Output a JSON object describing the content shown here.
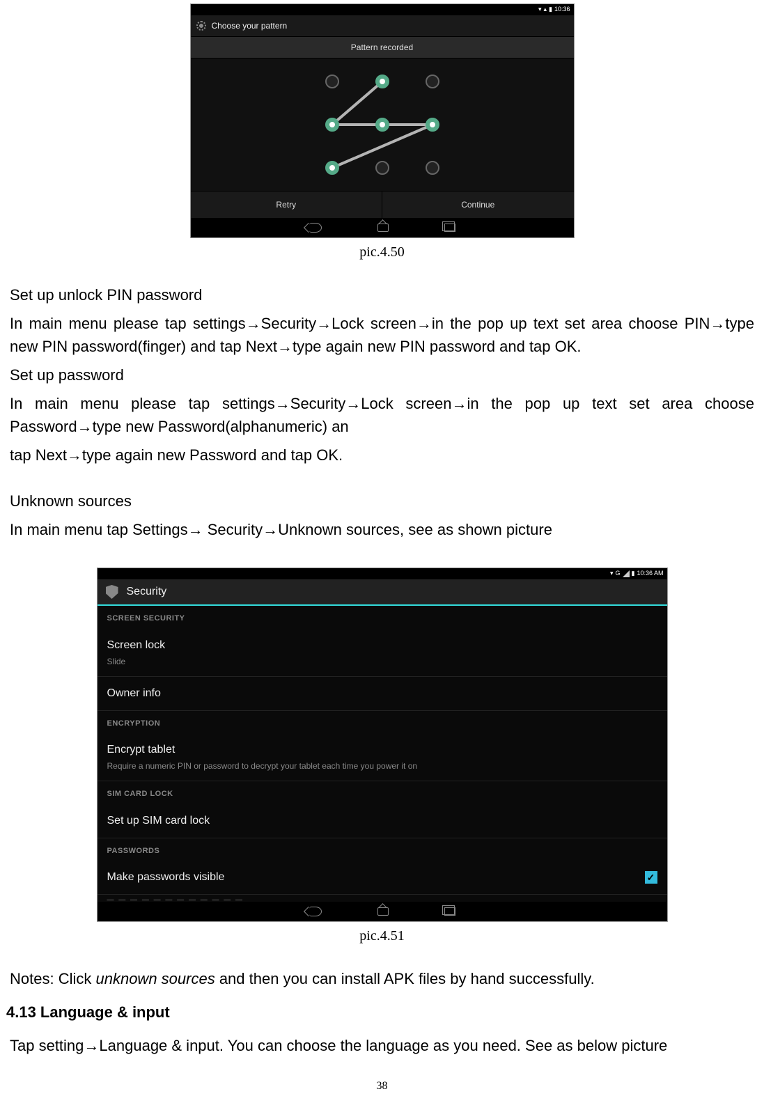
{
  "screenshot1": {
    "status_time": "10:36",
    "title": "Choose your pattern",
    "toast": "Pattern recorded",
    "retry": "Retry",
    "continue": "Continue"
  },
  "caption1": "pic.4.50",
  "text": {
    "h1": "Set up unlock PIN password",
    "p1": "In main menu please tap settings→Security→Lock screen→in the pop up text set area choose PIN→type new PIN password(finger) and tap Next→type again new PIN password and tap OK.",
    "h2": "Set up password",
    "p2": "In main menu please tap settings→Security→Lock screen→in the pop up text set area choose Password→type new Password(alphanumeric) an",
    "p3": "tap Next→type again new Password and tap OK.",
    "h3": "Unknown sources",
    "p4": "In main menu tap Settings→ Security→Unknown sources, see as shown picture"
  },
  "screenshot2": {
    "status_time": "10:36 AM",
    "header": "Security",
    "cat1": "SCREEN SECURITY",
    "item1_title": "Screen lock",
    "item1_sub": "Slide",
    "item2_title": "Owner info",
    "cat2": "ENCRYPTION",
    "item3_title": "Encrypt tablet",
    "item3_sub": "Require a numeric PIN or password to decrypt your tablet each time you power it on",
    "cat3": "SIM CARD LOCK",
    "item4_title": "Set up SIM card lock",
    "cat4": "PASSWORDS",
    "item5_title": "Make passwords visible",
    "signal_label": "G"
  },
  "caption2": "pic.4.51",
  "notes_prefix": "Notes: Click ",
  "notes_italic": "unknown sources",
  "notes_suffix": " and then you can install APK files by hand successfully.",
  "section_heading": "4.13 Language & input",
  "section_body": "Tap setting→Language & input. You can choose the language as you need. See as below picture",
  "page_number": "38"
}
